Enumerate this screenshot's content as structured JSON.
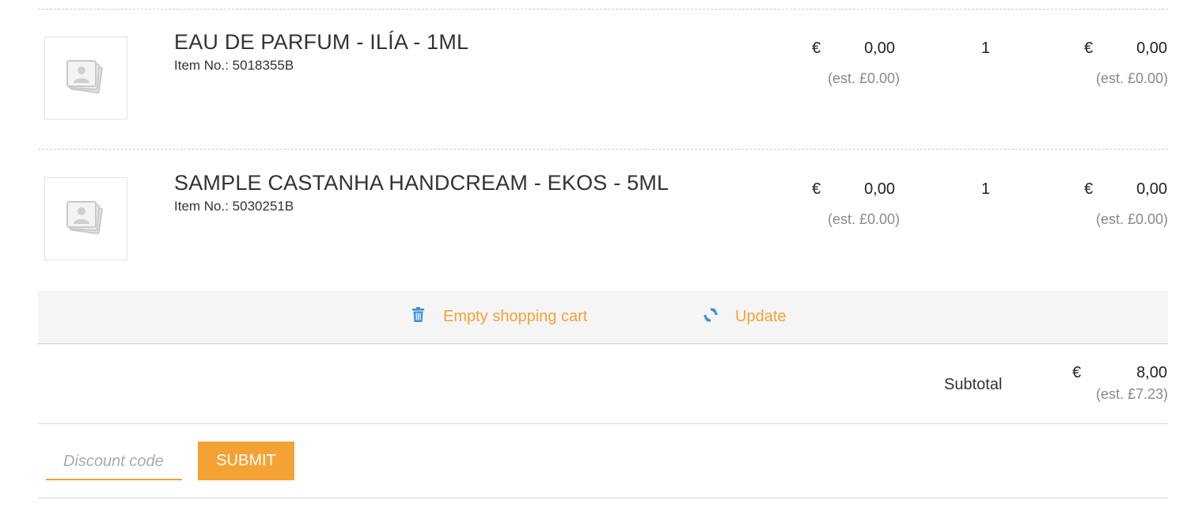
{
  "currency_symbol": "€",
  "items": [
    {
      "name": "EAU DE PARFUM - ILÍA - 1ML",
      "item_no": "Item No.: 5018355B",
      "price": "0,00",
      "price_est": "(est. £0.00)",
      "quantity": "1",
      "total": "0,00",
      "total_est": "(est. £0.00)",
      "thumbnail_icon": "image-placeholder-icon"
    },
    {
      "name": "SAMPLE CASTANHA HANDCREAM - EKOS - 5ML",
      "item_no": "Item No.: 5030251B",
      "price": "0,00",
      "price_est": "(est. £0.00)",
      "quantity": "1",
      "total": "0,00",
      "total_est": "(est. £0.00)",
      "thumbnail_icon": "image-placeholder-icon"
    }
  ],
  "actions": {
    "empty_cart_label": "Empty shopping cart",
    "empty_cart_icon": "trash-icon",
    "update_label": "Update",
    "update_icon": "refresh-icon"
  },
  "summary": {
    "subtotal_label": "Subtotal",
    "subtotal_value": "8,00",
    "subtotal_est": "(est. £7.23)"
  },
  "discount": {
    "placeholder": "Discount code",
    "value": "",
    "submit_label": "SUBMIT"
  },
  "colors": {
    "accent": "#f5a235",
    "icon_blue": "#3b8fd6",
    "muted_text": "#8a8a8a",
    "action_bar_bg": "#f5f5f5"
  }
}
